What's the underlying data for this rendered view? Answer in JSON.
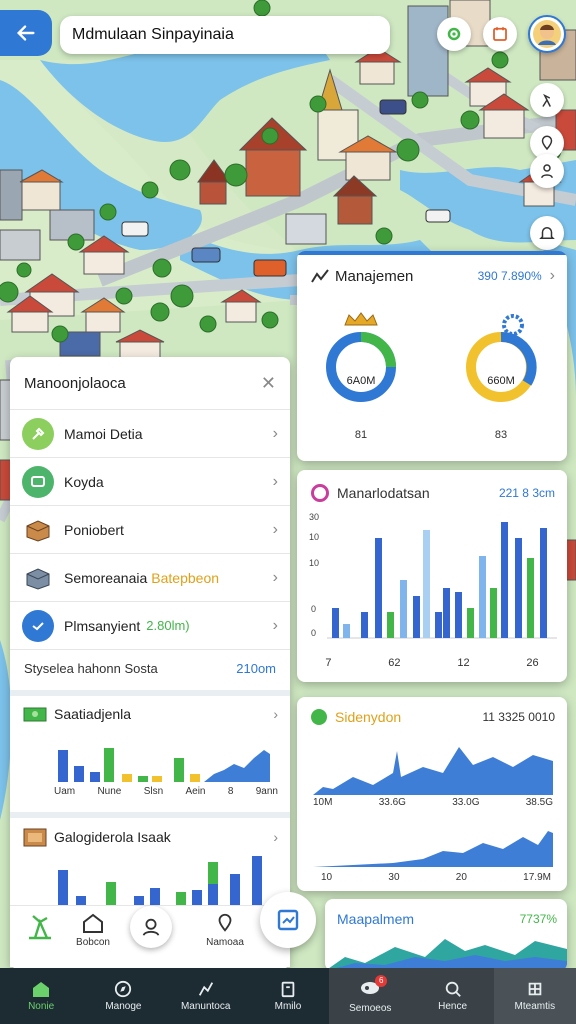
{
  "search": {
    "value": "Mdmulaan Sinpayinaia"
  },
  "management_card": {
    "title": "Manajemen",
    "value": "390 7.890%",
    "gauge_left": "6A0M",
    "gauge_right": "660M",
    "caption_left": "81",
    "caption_right": "83"
  },
  "panel": {
    "title": "Manoonjolaoca",
    "items": [
      {
        "label": "Mamoi Detia",
        "extra": ""
      },
      {
        "label": "Koyda",
        "extra": ""
      },
      {
        "label": "Poniobert",
        "extra": ""
      },
      {
        "label": "Semoreanaia",
        "extra": "Batepbeon"
      },
      {
        "label": "Plmsanyient",
        "extra": "2.80lm)"
      }
    ],
    "summary_label": "Styselea hahonn Sosta",
    "summary_value": "210om"
  },
  "subcard_1": {
    "title": "Saatiadjenla",
    "x_labels": [
      "Uam",
      "Nune",
      "Slsn",
      "Aein",
      "8",
      "9ann"
    ]
  },
  "subcard_2": {
    "title": "Galogiderola Isaak"
  },
  "bar_card": {
    "title": "Manarlodatsan",
    "value": "221 8 3cm",
    "y_labels": [
      "30",
      "10",
      "10",
      "0",
      "0"
    ],
    "x_labels": [
      "7",
      "62",
      "12",
      "26"
    ]
  },
  "area_card_1": {
    "title": "Sidenydon",
    "value": "11 3325 0010",
    "x_labels": [
      "10M",
      "33.6G",
      "33.0G",
      "38.5G"
    ],
    "lower_x_labels": [
      "10",
      "30",
      "20",
      "17.9M"
    ]
  },
  "area_card_2": {
    "title": "Maapalmem",
    "value": "7737%"
  },
  "bottom_nav": [
    {
      "label": "Nonie"
    },
    {
      "label": "Manoge"
    },
    {
      "label": "Manuntoca"
    },
    {
      "label": "Mmilo"
    },
    {
      "label": "Semoeos"
    },
    {
      "label": "Hence"
    },
    {
      "label": "Mteamtis"
    }
  ],
  "float_nav": [
    {
      "label": "Bobcon"
    },
    {
      "label": ""
    },
    {
      "label": "Namoaa"
    }
  ],
  "colors": {
    "accent_blue": "#2f78d4",
    "green": "#43b649",
    "yellow": "#f2c12e",
    "nav_bg": "#1d2b33"
  }
}
